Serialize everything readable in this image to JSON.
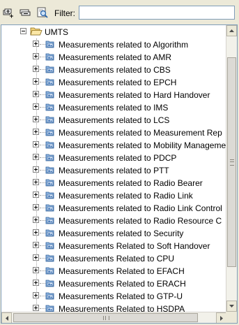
{
  "toolbar": {
    "expand_icon": "expand-all-icon",
    "collapse_icon": "collapse-all-icon",
    "find_icon": "find-icon",
    "filter_label": "Filter:",
    "filter_value": ""
  },
  "tree": {
    "root": {
      "label": "UMTS",
      "icon": "open-folder-icon",
      "expanded": true
    },
    "items": [
      "Measurements related to Algorithm",
      "Measurements related to AMR",
      "Measurements related to CBS",
      "Measurements related to EPCH",
      "Measurements related to Hard Handover",
      "Measurements related to IMS",
      "Measurements related to LCS",
      "Measurements related to Measurement Rep",
      "Measurements related to Mobility Manageme",
      "Measurements related to PDCP",
      "Measurements related to PTT",
      "Measurements related to Radio Bearer",
      "Measurements related to Radio Link",
      "Measurements related to Radio Link Control",
      "Measurements related to Radio Resource C",
      "Measurements related to Security",
      "Measurements Related to Soft Handover",
      "Measurements Related to CPU",
      "Measurements Related to EFACH",
      "Measurements Related to ERACH",
      "Measurements Related to GTP-U",
      "Measurements Related to HSDPA"
    ],
    "item_icon": "measurement-group-icon"
  },
  "colors": {
    "background": "#ece9d8",
    "tree_background": "#ffffff",
    "border": "#7f9db9"
  }
}
